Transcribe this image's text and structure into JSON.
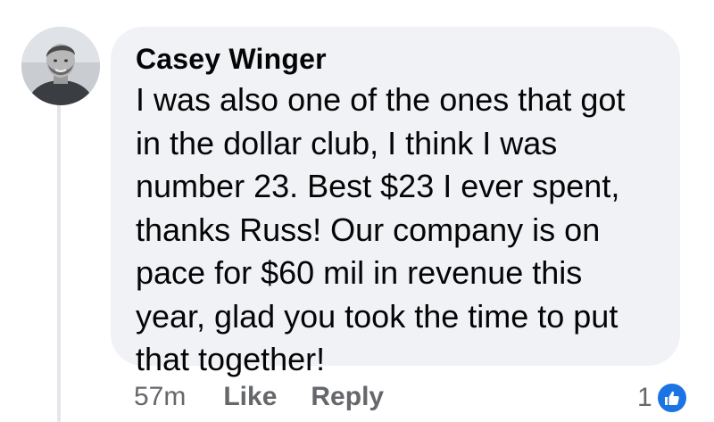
{
  "comment": {
    "author": "Casey Winger",
    "text_lines": [
      "I was also one of the ones that got",
      "in the dollar club, I think I was",
      "number 23. Best $23 I ever spent,",
      "thanks Russ! Our company is on",
      "pace for $60 mil in revenue this",
      "year, glad you took the time to put",
      "that together!"
    ],
    "timestamp": "57m",
    "like_label": "Like",
    "reply_label": "Reply",
    "reaction_count": "1",
    "reaction_icon": "thumbs-up-icon"
  },
  "colors": {
    "bubble": "#f0f2f5",
    "text": "#050505",
    "meta": "#65676b",
    "accent": "#1b74e4"
  }
}
